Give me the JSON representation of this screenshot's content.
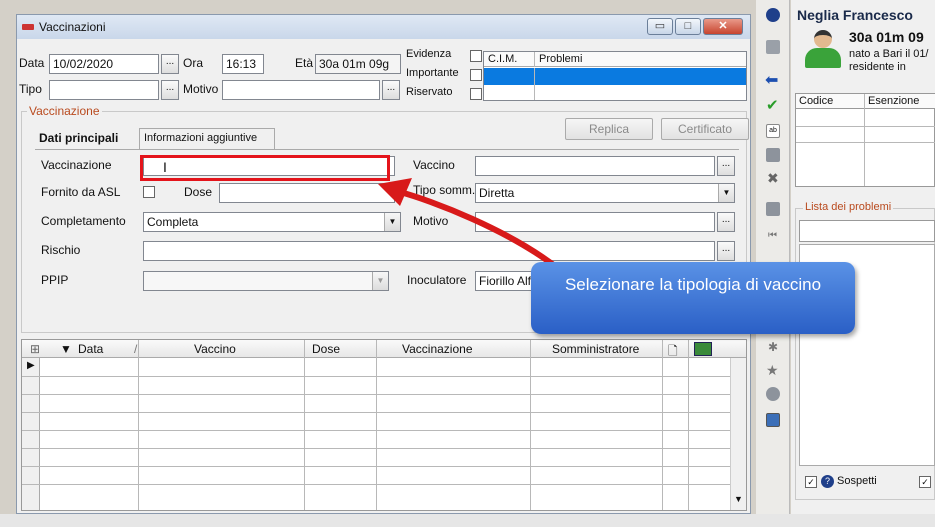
{
  "window": {
    "title": "Vaccinazioni",
    "controls": {
      "minimize": "▭",
      "maximize": "□",
      "close": "✕"
    }
  },
  "header": {
    "data_label": "Data",
    "data_value": "10/02/2020",
    "ora_label": "Ora",
    "ora_value": "16:13",
    "eta_label": "Età",
    "eta_value": "30a 01m 09g",
    "tipo_label": "Tipo",
    "tipo_value": "",
    "motivo_label": "Motivo",
    "motivo_value": "",
    "evidenza_label": "Evidenza",
    "importante_label": "Importante",
    "riservato_label": "Riservato",
    "problems_columns": [
      "C.I.M.",
      "Problemi"
    ]
  },
  "section": {
    "title": "Vaccinazione",
    "tabs": [
      "Dati principali",
      "Informazioni aggiuntive"
    ],
    "replica_label": "Replica",
    "certificato_label": "Certificato"
  },
  "form": {
    "vaccinazione_label": "Vaccinazione",
    "vaccinazione_value": "",
    "vaccino_label": "Vaccino",
    "vaccino_value": "",
    "fornito_label": "Fornito da ASL",
    "dose_label": "Dose",
    "dose_value": "",
    "tipo_somm_label": "Tipo somm.",
    "tipo_somm_value": "Diretta",
    "completamento_label": "Completamento",
    "completamento_value": "Completa",
    "motivo_label": "Motivo",
    "motivo_value": "",
    "rischio_label": "Rischio",
    "rischio_value": "",
    "ppip_label": "PPIP",
    "ppip_value": "",
    "inoculatore_label": "Inoculatore",
    "inoculatore_value": "Fiorillo Alf"
  },
  "grid": {
    "columns": [
      "Data",
      "Vaccino",
      "Dose",
      "Vaccinazione",
      "Somministratore"
    ]
  },
  "callout": {
    "text": "Selezionare la tipologia di vaccino"
  },
  "patient": {
    "name": "Neglia Francesco",
    "age": "30a 01m 09",
    "birth": "nato a Bari il 01/",
    "residence": "residente in",
    "table_columns": [
      "Codice",
      "Esenzione"
    ],
    "problems_list_label": "Lista dei problemi",
    "sospetti_label": "Sospetti"
  },
  "colors": {
    "selection": "#0a7ae0",
    "highlight_box": "#e4141b",
    "callout": "#3f78d8"
  }
}
